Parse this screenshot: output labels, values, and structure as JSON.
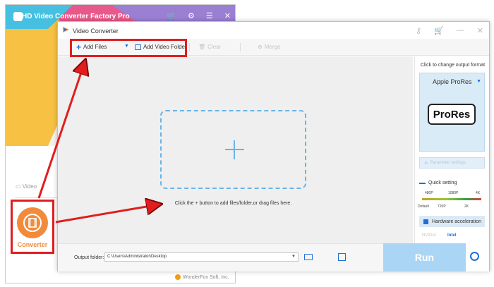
{
  "bg_window": {
    "title": "HD Video Converter Factory Pro",
    "icons": [
      "cart-icon",
      "settings-icon",
      "menu-icon",
      "close-icon"
    ],
    "video_label": "Video",
    "converter_label": "Converter",
    "footer": "WonderFox Soft, Inc."
  },
  "vc_window": {
    "title": "Video Converter",
    "toolbar": {
      "add_files": "Add Files",
      "add_video_folder": "Add Video Folder",
      "clear": "Clear",
      "merge": "Merge"
    },
    "hint": "Click the + button to add files/folder,or drag files here.",
    "sidebar": {
      "title": "Click to change output format",
      "format_name": "Apple ProRes",
      "format_logo": "ProRes",
      "parameter_settings": "Parameter settings",
      "quick_setting": "Quick setting",
      "resolutions_top": [
        "480P",
        "1080P",
        "4K"
      ],
      "resolutions_bottom": [
        "Default",
        "720P",
        "2K"
      ],
      "hardware_acceleration": "Hardware acceleration",
      "gpu_nvidia": "NVIDIA",
      "gpu_intel": "Intel"
    },
    "bottom": {
      "output_label": "Output folder:",
      "output_path": "C:\\Users\\Administrator\\Desktop",
      "run": "Run"
    }
  },
  "colors": {
    "accent": "#1e6fd9",
    "highlight": "#e01e1e",
    "converter_orange": "#f18b3b",
    "run_button": "#abd5f4"
  }
}
